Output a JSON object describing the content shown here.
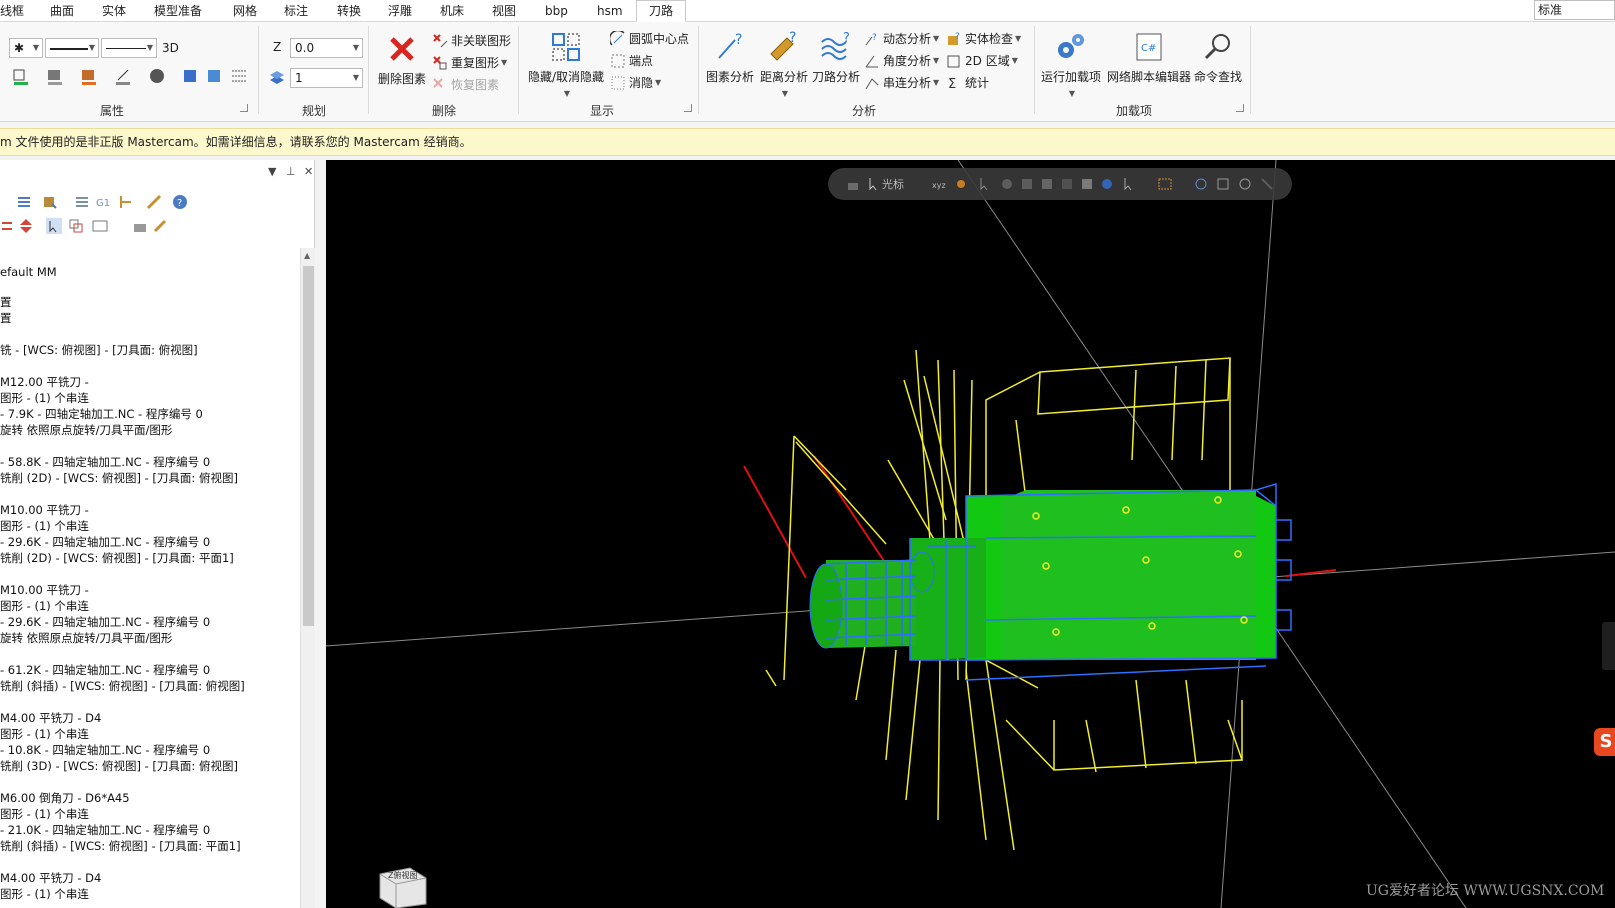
{
  "menu": {
    "tabs": [
      "线框",
      "曲面",
      "实体",
      "模型准备",
      "网格",
      "标注",
      "转换",
      "浮雕",
      "机床",
      "视图",
      "bbp",
      "hsm",
      "刀路"
    ],
    "active_tab": "刀路",
    "style_select": "标准"
  },
  "ribbon": {
    "attributes": {
      "title": "属性",
      "line_width_label": "3D"
    },
    "planning": {
      "title": "规划",
      "z_label": "Z",
      "z_value": "0.0",
      "level_value": "1"
    },
    "delete": {
      "title": "删除",
      "delete_entity": "删除图素",
      "delete_unassociated": "非关联图形",
      "duplicate": "重复图形",
      "restore": "恢复图素"
    },
    "display": {
      "title": "显示",
      "hide_unhide": "隐藏/取消隐藏",
      "arc_center": "圆弧中心点",
      "endpoints": "端点",
      "blank": "消隐"
    },
    "analyze": {
      "title": "分析",
      "entity_analysis": "图素分析",
      "distance_analysis": "距离分析",
      "toolpath_analysis": "刀路分析",
      "dynamic_analysis": "动态分析",
      "angle_analysis": "角度分析",
      "chain_analysis": "串连分析",
      "solid_check": "实体检查",
      "area_2d": "2D 区域",
      "statistics": "统计"
    },
    "addins": {
      "title": "加载项",
      "run_addin": "运行加载项",
      "net_script_editor": "网络脚本编辑器",
      "command_finder": "命令查找"
    }
  },
  "warning": {
    "text": "m 文件使用的是非正版 Mastercam。如需详细信息，请联系您的 Mastercam 经销商。"
  },
  "toolpath_tree": {
    "rows": [
      "efault MM",
      "置",
      "置",
      "铣 - [WCS: 俯视图] - [刀具面: 俯视图]",
      "M12.00 平铣刀 -",
      "图形 - (1) 个串连",
      " - 7.9K - 四轴定轴加工.NC - 程序编号 0",
      "旋转 依照原点旋转/刀具平面/图形",
      " - 58.8K - 四轴定轴加工.NC - 程序编号 0",
      "铣削 (2D) - [WCS: 俯视图] - [刀具面: 俯视图]",
      "M10.00 平铣刀 -",
      "图形 - (1) 个串连",
      " - 29.6K - 四轴定轴加工.NC - 程序编号 0",
      "铣削 (2D) - [WCS: 俯视图] - [刀具面: 平面1]",
      "M10.00 平铣刀 -",
      "图形 - (1) 个串连",
      " - 29.6K - 四轴定轴加工.NC - 程序编号 0",
      "旋转 依照原点旋转/刀具平面/图形",
      " - 61.2K - 四轴定轴加工.NC - 程序编号 0",
      "铣削 (斜插) - [WCS: 俯视图] - [刀具面: 俯视图]",
      "M4.00 平铣刀 - D4",
      "图形 - (1) 个串连",
      " - 10.8K - 四轴定轴加工.NC - 程序编号 0",
      "铣削 (3D) - [WCS: 俯视图] - [刀具面: 俯视图]",
      "M6.00 倒角刀 - D6*A45",
      "图形 - (1) 个串连",
      " - 21.0K - 四轴定轴加工.NC - 程序编号 0",
      "铣削 (斜插) - [WCS: 俯视图] - [刀具面: 平面1]",
      "M4.00 平铣刀 - D4",
      "图形 - (1) 个串连"
    ]
  },
  "viewport": {
    "toolbar_label": "光标",
    "watermark": "UG爱好者论坛 WWW.UGSNX.COM",
    "viewcube_label": "Z俯视图",
    "ime_badge": "S"
  },
  "colors": {
    "part": "#1fbf1f",
    "wire": "#f2ee2a",
    "edges": "#2f6fff",
    "axis_red": "#e01010",
    "background": "#000000"
  }
}
